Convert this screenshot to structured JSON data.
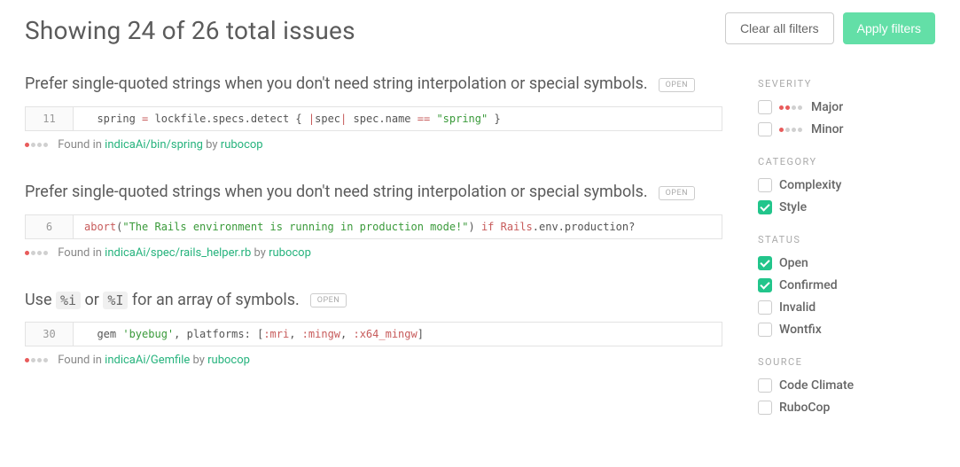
{
  "header": {
    "title": "Showing 24 of 26 total issues",
    "clear_label": "Clear all filters",
    "apply_label": "Apply filters"
  },
  "issues": [
    {
      "title_plain": "Prefer single-quoted strings when you don't need string interpolation or special symbols.",
      "badge": "OPEN",
      "line_no": "11",
      "found_in_prefix": "Found in ",
      "file": "indicaAi/bin/spring",
      "by": " by ",
      "engine": "rubocop",
      "severity_dots": [
        "red",
        "gray",
        "gray",
        "gray"
      ]
    },
    {
      "title_plain": "Prefer single-quoted strings when you don't need string interpolation or special symbols.",
      "badge": "OPEN",
      "line_no": "6",
      "found_in_prefix": "Found in ",
      "file": "indicaAi/spec/rails_helper.rb",
      "by": " by ",
      "engine": "rubocop",
      "severity_dots": [
        "red",
        "gray",
        "gray",
        "gray"
      ]
    },
    {
      "title_parts": [
        "Use ",
        "%i",
        " or ",
        "%I",
        " for an array of symbols."
      ],
      "badge": "OPEN",
      "line_no": "30",
      "found_in_prefix": "Found in ",
      "file": "indicaAi/Gemfile",
      "by": " by ",
      "engine": "rubocop",
      "severity_dots": [
        "red",
        "gray",
        "gray",
        "gray"
      ]
    }
  ],
  "filters": {
    "severity": {
      "heading": "SEVERITY",
      "items": [
        {
          "label": "Major",
          "checked": false,
          "dots": [
            "red",
            "red",
            "gray",
            "gray"
          ]
        },
        {
          "label": "Minor",
          "checked": false,
          "dots": [
            "red",
            "gray",
            "gray",
            "gray"
          ]
        }
      ]
    },
    "category": {
      "heading": "CATEGORY",
      "items": [
        {
          "label": "Complexity",
          "checked": false
        },
        {
          "label": "Style",
          "checked": true
        }
      ]
    },
    "status": {
      "heading": "STATUS",
      "items": [
        {
          "label": "Open",
          "checked": true
        },
        {
          "label": "Confirmed",
          "checked": true
        },
        {
          "label": "Invalid",
          "checked": false
        },
        {
          "label": "Wontfix",
          "checked": false
        }
      ]
    },
    "source": {
      "heading": "SOURCE",
      "items": [
        {
          "label": "Code Climate",
          "checked": false
        },
        {
          "label": "RuboCop",
          "checked": false
        }
      ]
    }
  }
}
